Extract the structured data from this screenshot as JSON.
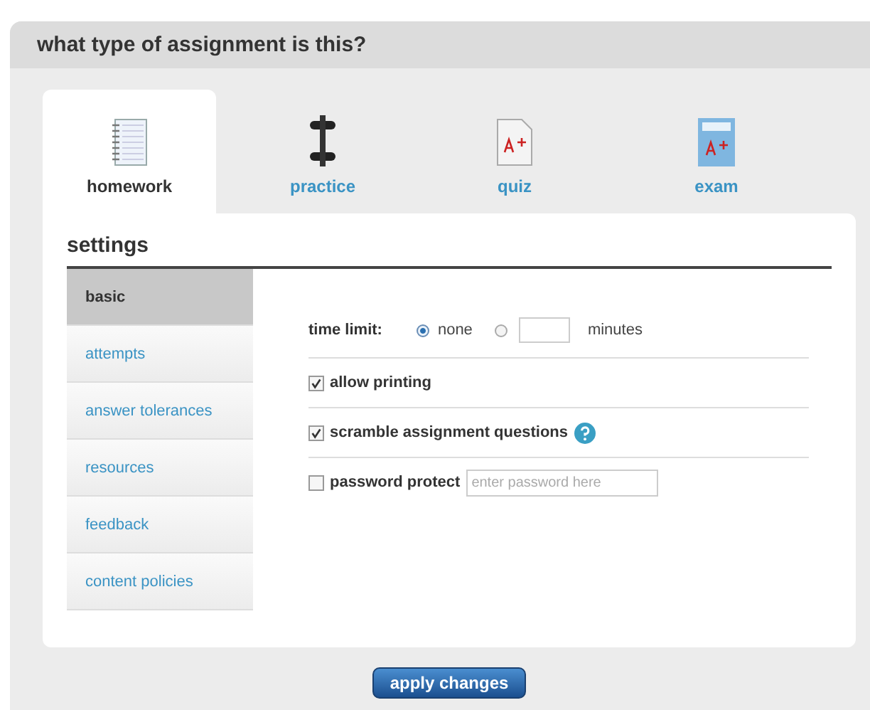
{
  "header": {
    "title": "what type of assignment is this?"
  },
  "tabs": [
    {
      "label": "homework",
      "kind": "notebook",
      "selected": true
    },
    {
      "label": "practice",
      "kind": "dumbbell",
      "selected": false
    },
    {
      "label": "quiz",
      "kind": "paper",
      "selected": false
    },
    {
      "label": "exam",
      "kind": "card",
      "selected": false
    }
  ],
  "settings": {
    "title": "settings",
    "menu": [
      {
        "label": "basic",
        "selected": true
      },
      {
        "label": "attempts",
        "selected": false
      },
      {
        "label": "answer tolerances",
        "selected": false
      },
      {
        "label": "resources",
        "selected": false
      },
      {
        "label": "feedback",
        "selected": false
      },
      {
        "label": "content policies",
        "selected": false
      }
    ],
    "time_limit": {
      "label": "time limit:",
      "options": [
        {
          "label": "none",
          "selected": true
        },
        {
          "selected": false
        }
      ],
      "unit": "minutes"
    },
    "options": [
      {
        "label": "allow printing",
        "checked": true
      },
      {
        "label": "scramble assignment questions",
        "checked": true,
        "help": true
      },
      {
        "label": "password protect",
        "checked": false,
        "placeholder": "enter password here"
      }
    ]
  },
  "apply_button": "apply changes"
}
